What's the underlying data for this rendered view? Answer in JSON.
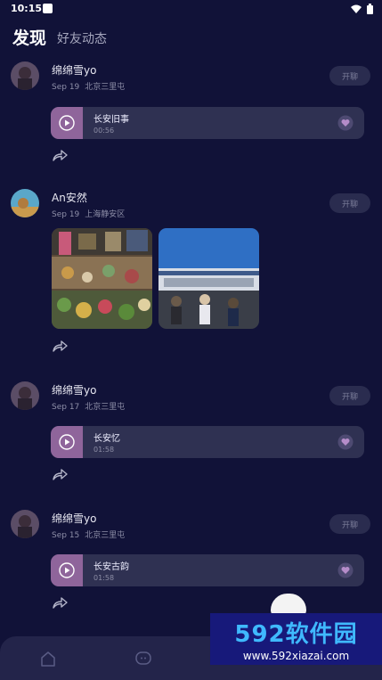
{
  "status": {
    "time": "10:15"
  },
  "tabs": {
    "discover": "发现",
    "friends": "好友动态"
  },
  "posts": [
    {
      "user": "绵绵雪yo",
      "date": "Sep 19",
      "location": "北京三里屯",
      "chat": "开聊",
      "audio": {
        "title": "长安旧事",
        "duration": "00:56"
      }
    },
    {
      "user": "An安然",
      "date": "Sep 19",
      "location": "上海静安区",
      "chat": "开聊"
    },
    {
      "user": "绵绵雪yo",
      "date": "Sep 17",
      "location": "北京三里屯",
      "chat": "开聊",
      "audio": {
        "title": "长安忆",
        "duration": "01:58"
      }
    },
    {
      "user": "绵绵雪yo",
      "date": "Sep 15",
      "location": "北京三里屯",
      "chat": "开聊",
      "audio": {
        "title": "长安古韵",
        "duration": "01:58"
      }
    }
  ],
  "watermark": {
    "main": "592软件园",
    "sub": "www.592xiazai.com"
  },
  "icons": [
    "play-icon",
    "heart-icon",
    "share-icon",
    "home-icon",
    "message-icon",
    "wifi-icon",
    "battery-icon"
  ],
  "colors": {
    "background": "#111238",
    "accent": "#8f659b",
    "card": "#2f3152"
  }
}
